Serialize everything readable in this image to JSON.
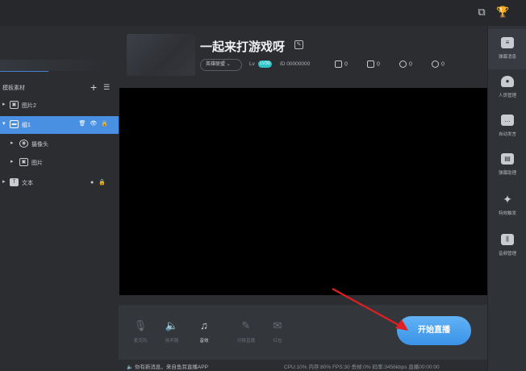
{
  "left_panel": {
    "title": "模板素材",
    "items": [
      {
        "label": "图片2",
        "icon": "image-icon"
      },
      {
        "label": "组1",
        "icon": "folder-icon"
      },
      {
        "label": "摄像头",
        "icon": "camera-icon"
      },
      {
        "label": "图片",
        "icon": "image-icon"
      },
      {
        "label": "文本",
        "icon": "text-icon"
      }
    ]
  },
  "header": {
    "room_title": "一起来打游戏呀",
    "category": "英雄联盟 ⌄",
    "level_label": "Lv",
    "level_badge": "LV30",
    "id_text": "ID 00000000",
    "stats": [
      "0",
      "0",
      "0",
      "0"
    ]
  },
  "toolbar": {
    "tools": [
      {
        "label": "麦克风",
        "glyph": "🎙",
        "active": false
      },
      {
        "label": "扬声器",
        "glyph": "🔈",
        "active": false
      },
      {
        "label": "音效",
        "glyph": "♫",
        "active": true
      },
      {
        "label": "切换直播",
        "glyph": "✎",
        "active": false
      },
      {
        "label": "红包",
        "glyph": "✉",
        "active": false
      }
    ],
    "start_label": "开始直播"
  },
  "status": {
    "message": "你有新消息，来自鱼耳直播APP",
    "perf": "CPU:10%  内存:80%  FPS:30  丢帧:0%  码率:3456kbps  直播00:00:00"
  },
  "right_sidebar": [
    {
      "label": "弹幕消息",
      "icon": "chat-icon"
    },
    {
      "label": "人员管理",
      "icon": "users-icon"
    },
    {
      "label": "自动发言",
      "icon": "message-icon"
    },
    {
      "label": "弹幕助理",
      "icon": "assistant-icon"
    },
    {
      "label": "特效触发",
      "icon": "effects-icon"
    },
    {
      "label": "音频管理",
      "icon": "audio-icon"
    }
  ],
  "colors": {
    "accent": "#4a90e2",
    "start_button": "#3a92e8",
    "level_badge": "#2ec3c7",
    "arrow": "#e02020"
  }
}
